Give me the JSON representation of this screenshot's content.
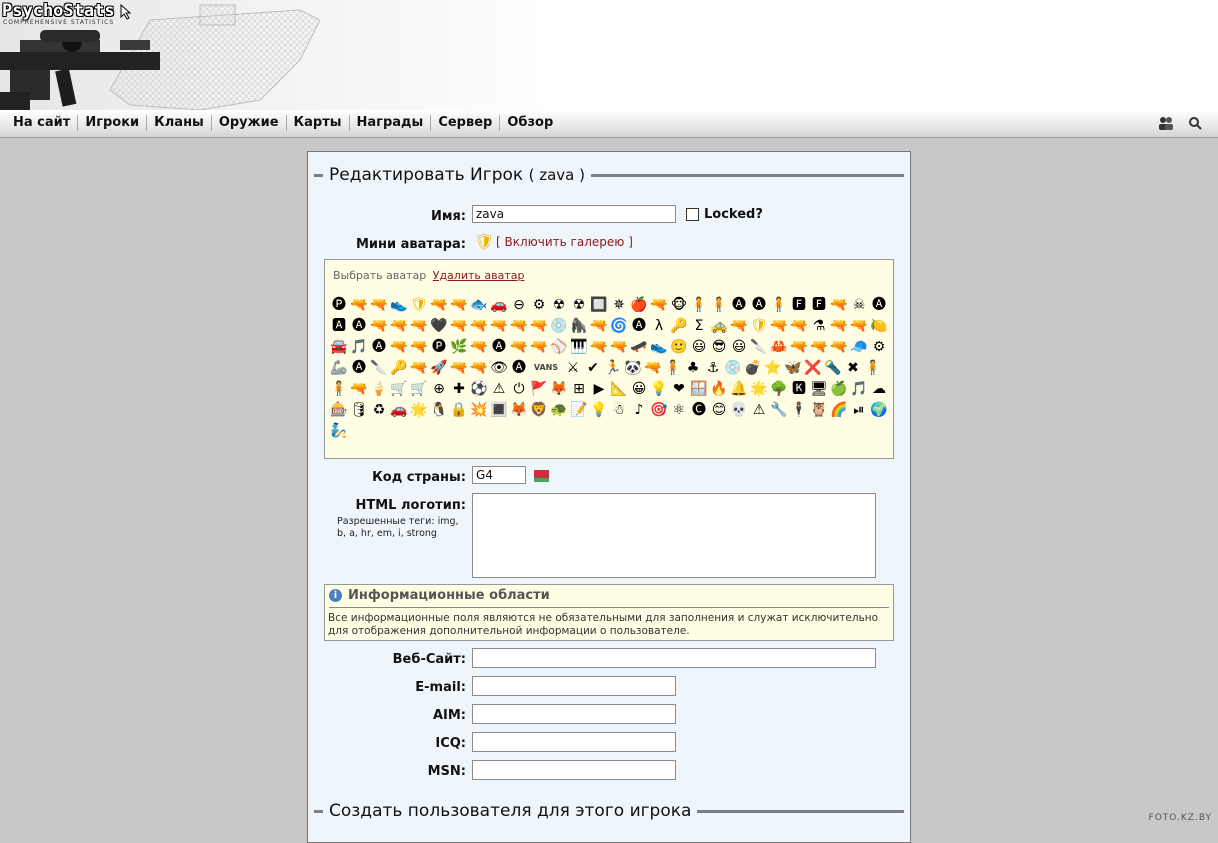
{
  "logo": {
    "title": "PsychoStats",
    "subtitle": "COMPREHENSIVE STATISTICS"
  },
  "nav": {
    "items": [
      "На сайт",
      "Игроки",
      "Кланы",
      "Оружие",
      "Карты",
      "Награды",
      "Сервер",
      "Обзор"
    ],
    "icons": [
      "users-icon",
      "search-icon"
    ]
  },
  "form": {
    "title": "Редактировать Игрок",
    "player_name_paren": "( zava )",
    "name_label": "Имя:",
    "name_value": "zava",
    "locked_label": "Locked?",
    "mini_avatar_label": "Мини аватара:",
    "gallery_link": "Включить галерею",
    "gallery_bracket_open": "[",
    "gallery_bracket_close": "]",
    "avatar_choose": "Выбрать аватар",
    "avatar_delete": "Удалить аватар",
    "avatar_icons": [
      "🅟",
      "🔫",
      "🔫",
      "👟",
      "🛡",
      "🔫",
      "🔫",
      "🐟",
      "🚗",
      "⊖",
      "⚙",
      "☢",
      "☢",
      "🔲",
      "✵",
      "🍎",
      "🔫",
      "🐵",
      "🧍",
      "🧍",
      "🅐",
      "🅐",
      "🧍",
      "🅵",
      "🅵",
      "🔫",
      "☠",
      "🅐",
      "🅰",
      "🅐",
      "🔫",
      "🔫",
      "🔫",
      "🖤",
      "🔫",
      "🔫",
      "🔫",
      "🔫",
      "🔫",
      "💿",
      "🦍",
      "🔫",
      "🌀",
      "🅐",
      "λ",
      "🔑",
      "Σ",
      "🚕",
      "🔫",
      "🛡",
      "🔫",
      "🔫",
      "⚗",
      "🔫",
      "🔫",
      "🍋",
      "🚘",
      "🎵",
      "🅐",
      "🔫",
      "🔫",
      "🅟",
      "🌿",
      "🔫",
      "🅐",
      "🔫",
      "🔫",
      "⚾",
      "🎹",
      "🔫",
      "🔫",
      "🛹",
      "👟",
      "🙂",
      "😃",
      "😎",
      "😃",
      "🔪",
      "🦀",
      "🔫",
      "🔫",
      "🔫",
      "🧢",
      "⚙",
      "🦾",
      "🅐",
      "🔪",
      "🔑",
      "🔫",
      "🚀",
      "🔫",
      "🔫",
      "👁",
      "🅐",
      "VANS",
      "⚔",
      "✔",
      "🏃",
      "🐼",
      "🔫",
      "🧍",
      "♣",
      "⚓",
      "💿",
      "💣",
      "⭐",
      "🦋",
      "❌",
      "🔦",
      "✖",
      "🧍",
      "🧍",
      "🔫",
      "🍦",
      "🛒",
      "🛒",
      "⊕",
      "✚",
      "⚽",
      "⚠",
      "⏻",
      "🚩",
      "🦊",
      "⊞",
      "▶",
      "📐",
      "😀",
      "💡",
      "❤",
      "🪟",
      "🔥",
      "🔔",
      "🌟",
      "🌳",
      "🅺",
      "🖥",
      "🍏",
      "🎵",
      "☁",
      "🎰",
      "🛢",
      "♻",
      "🚗",
      "🌟",
      "🐧",
      "🔒",
      "💥",
      "🔳",
      "🦊",
      "🦁",
      "🐢",
      "📝",
      "💡",
      "☃",
      "♪",
      "🎯",
      "⚛",
      "🅒",
      "😊",
      "💀",
      "⚠",
      "🔧",
      "🕴",
      "🦉",
      "🌈",
      "⏯",
      "🌍",
      "🧞"
    ],
    "country_label": "Код страны:",
    "country_value": "G4",
    "html_logo_label": "HTML логотип:",
    "html_logo_hint": "Разрешенные теги: img, b, a, hr, em, i, strong",
    "html_logo_value": "",
    "info_title": "Информационные области",
    "info_text": "Все информационные поля являются не обязательными для заполнения и служат исключительно для отображения дополнительной информации о пользователе.",
    "website_label": "Веб-Сайт:",
    "website_value": "",
    "email_label": "E-mail:",
    "email_value": "",
    "aim_label": "AIM:",
    "aim_value": "",
    "icq_label": "ICQ:",
    "icq_value": "",
    "msn_label": "MSN:",
    "msn_value": "",
    "create_user_title": "Создать пользователя для этого игрока"
  },
  "watermark": "FOTO.KZ.BY",
  "colors": {
    "accent_link": "#8b1a1a",
    "avatar_gold": "#f0b400",
    "panel_bg": "#eef5fb"
  }
}
